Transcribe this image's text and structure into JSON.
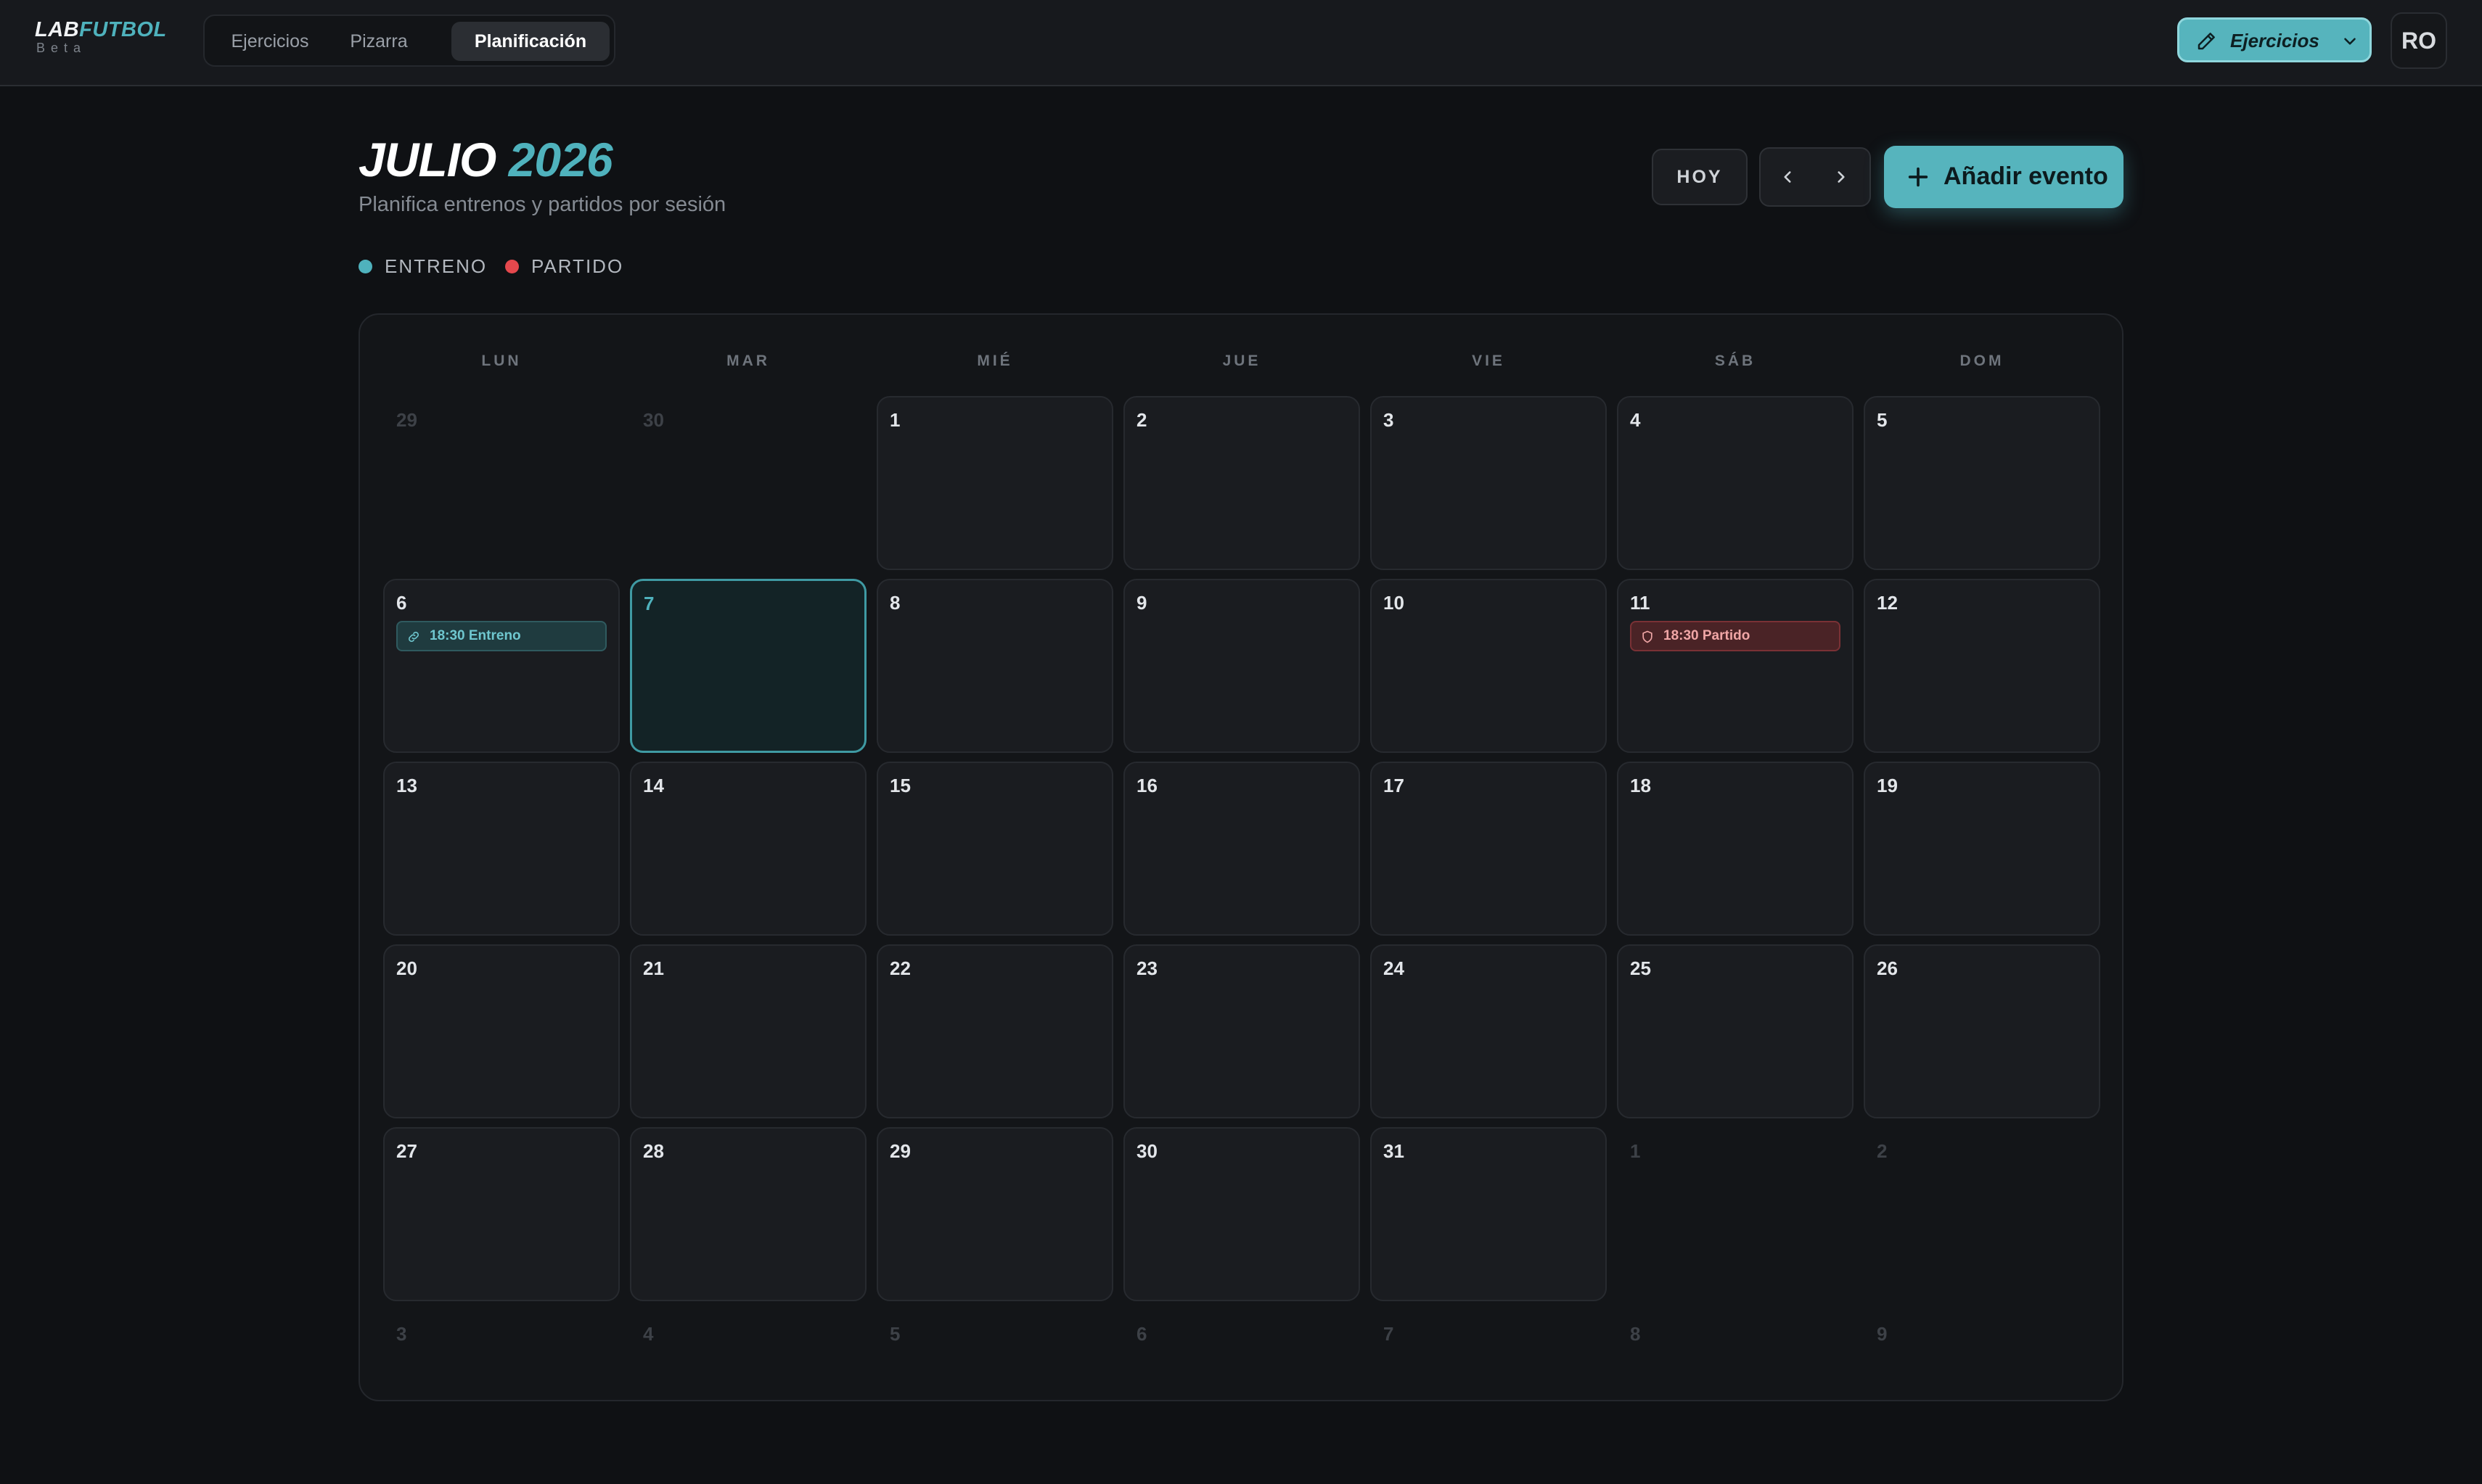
{
  "app": {
    "logo_prefix": "LAB",
    "logo_accent": "FUTBOL",
    "logo_sub": "Beta",
    "accent_color": "#4fb2bd",
    "match_color": "#e5484d"
  },
  "nav": {
    "tabs": [
      {
        "label": "Ejercicios",
        "active": false
      },
      {
        "label": "Pizarra",
        "active": false
      },
      {
        "label": "Planificación",
        "active": true
      }
    ]
  },
  "header_actions": {
    "ejercicios_button": "Ejercicios",
    "ejercicios_icon": "pencil-icon",
    "avatar_initials": "RO"
  },
  "calendar": {
    "month": "JULIO",
    "year": "2026",
    "subtitle": "Planifica entrenos y partidos por sesión",
    "today_button": "HOY",
    "prev_icon": "chevron-left-icon",
    "next_icon": "chevron-right-icon",
    "add_event_button": "Añadir evento",
    "legend": [
      {
        "label": "ENTRENO",
        "color": "#4fb2bd"
      },
      {
        "label": "PARTIDO",
        "color": "#e5484d"
      }
    ],
    "weekdays": [
      "LUN",
      "MAR",
      "MIÉ",
      "JUE",
      "VIE",
      "SÁB",
      "DOM"
    ],
    "weeks": [
      [
        {
          "d": "29",
          "other": true
        },
        {
          "d": "30",
          "other": true
        },
        {
          "d": "1"
        },
        {
          "d": "2"
        },
        {
          "d": "3"
        },
        {
          "d": "4"
        },
        {
          "d": "5"
        }
      ],
      [
        {
          "d": "6",
          "event": {
            "type": "entreno",
            "text": "18:30 Entreno",
            "icon": "training-icon"
          }
        },
        {
          "d": "7",
          "today": true
        },
        {
          "d": "8"
        },
        {
          "d": "9"
        },
        {
          "d": "10"
        },
        {
          "d": "11",
          "event": {
            "type": "partido",
            "text": "18:30 Partido",
            "icon": "shield-icon"
          }
        },
        {
          "d": "12"
        }
      ],
      [
        {
          "d": "13"
        },
        {
          "d": "14"
        },
        {
          "d": "15"
        },
        {
          "d": "16"
        },
        {
          "d": "17"
        },
        {
          "d": "18"
        },
        {
          "d": "19"
        }
      ],
      [
        {
          "d": "20"
        },
        {
          "d": "21"
        },
        {
          "d": "22"
        },
        {
          "d": "23"
        },
        {
          "d": "24"
        },
        {
          "d": "25"
        },
        {
          "d": "26"
        }
      ],
      [
        {
          "d": "27"
        },
        {
          "d": "28"
        },
        {
          "d": "29"
        },
        {
          "d": "30"
        },
        {
          "d": "31"
        },
        {
          "d": "1",
          "other": true
        },
        {
          "d": "2",
          "other": true
        }
      ],
      [
        {
          "d": "3",
          "other": true
        },
        {
          "d": "4",
          "other": true
        },
        {
          "d": "5",
          "other": true
        },
        {
          "d": "6",
          "other": true
        },
        {
          "d": "7",
          "other": true
        },
        {
          "d": "8",
          "other": true
        },
        {
          "d": "9",
          "other": true
        }
      ]
    ]
  }
}
